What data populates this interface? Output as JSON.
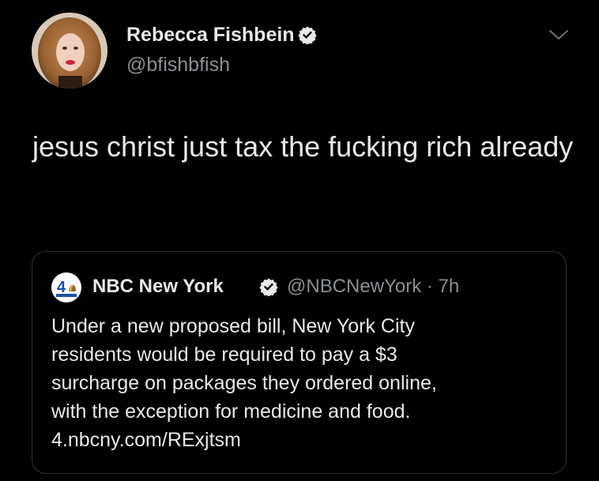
{
  "tweet": {
    "author": {
      "display_name": "Rebecca Fishbein",
      "handle": "@bfishbfish",
      "verified": true,
      "avatar_icon": "profile-photo"
    },
    "text": "jesus christ just tax the fucking rich already",
    "menu_icon": "chevron-down-icon"
  },
  "quoted_tweet": {
    "author": {
      "display_name": "NBC New York",
      "handle_time": "@NBCNewYork · 7h",
      "verified": true,
      "logo_icon": "nbc-4-logo"
    },
    "text_lines": [
      "Under a new proposed bill, New York City",
      "residents would be required to pay a $3",
      "surcharge on packages they ordered online,",
      "with the exception for medicine and food.",
      "4.nbcny.com/RExjtsm"
    ]
  },
  "colors": {
    "background": "#000000",
    "text_primary": "#e7e9ea",
    "text_secondary": "#8b8f93",
    "border": "#2f3336",
    "verified_badge": "#e7e9ea"
  }
}
